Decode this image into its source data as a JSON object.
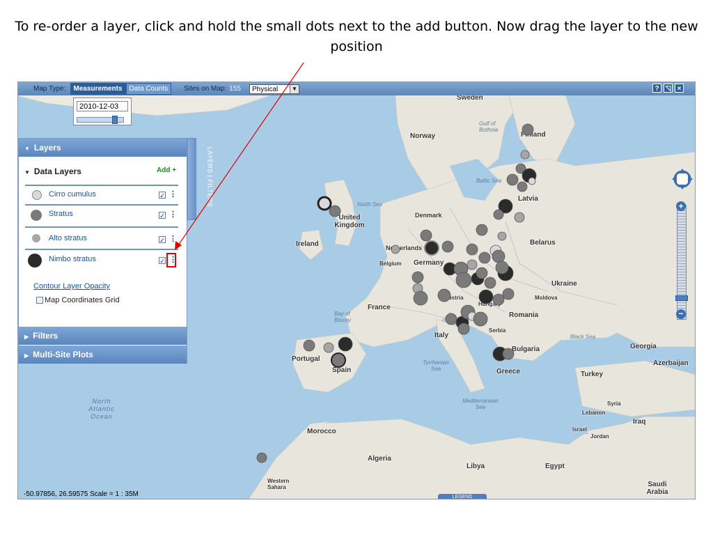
{
  "caption": "To re-order a layer, click and hold the small dots next to the add button. Now drag the layer to the new position",
  "toolbar": {
    "map_type_label": "Map Type:",
    "measurements_label": "Measurements",
    "data_counts_label": "Data Counts",
    "sites_label": "Sites on Map:",
    "sites_count": "155",
    "map_style_value": "Physical",
    "icons": [
      "help-icon",
      "map-style-icon",
      "close-icon"
    ]
  },
  "date_widget": {
    "date_value": "2010-12-03",
    "slider_position": 0.8
  },
  "panel": {
    "layers_header": "Layers",
    "data_layers_title": "Data Layers",
    "add_label": "Add +",
    "layers": [
      {
        "name": "Cirro cumulus",
        "color": "#d9d9d9",
        "checked": true
      },
      {
        "name": "Stratus",
        "color": "#7a7a7a",
        "checked": true
      },
      {
        "name": "Alto stratus",
        "color": "#a6a6a6",
        "checked": true
      },
      {
        "name": "Nimbo stratus",
        "color": "#2b2b2b",
        "checked": true
      }
    ],
    "contour_link": "Contour Layer Opacity",
    "coordinates_label": "Map Coordinates Grid",
    "filters_header": "Filters",
    "multisite_header": "Multi-Site Plots",
    "side_tab": "LAYERS | FILTERS"
  },
  "map": {
    "countries": [
      "Sweden",
      "Norway",
      "Finland",
      "Latvia",
      "Denmark",
      "United Kingdom",
      "Ireland",
      "Netherlands",
      "Belgium",
      "Germany",
      "Belarus",
      "Ukraine",
      "France",
      "Austria",
      "Hungary",
      "Moldova",
      "Romania",
      "Serbia",
      "Italy",
      "Bulgaria",
      "Portugal",
      "Spain",
      "Greece",
      "Turkey",
      "Georgia",
      "Azerbaijan",
      "Syria",
      "Lebanon",
      "Iraq",
      "Israel",
      "Jordan",
      "Morocco",
      "Algeria",
      "Libya",
      "Egypt",
      "Western Sahara",
      "Saudi Arabia"
    ],
    "seas": [
      "North Sea",
      "Baltic Sea",
      "Gulf of Bothnia",
      "Bay of Biscay",
      "Tyrrhenian Sea",
      "Mediterranean Sea",
      "Black Sea"
    ],
    "ocean": "North Atlantic Ocean",
    "legend_label": "LEGEND",
    "status_text": "-50.97856, 26.59575 Scale = 1 : 35M",
    "accent_color": "#5d86b7",
    "annotation_color": "#e00000"
  }
}
